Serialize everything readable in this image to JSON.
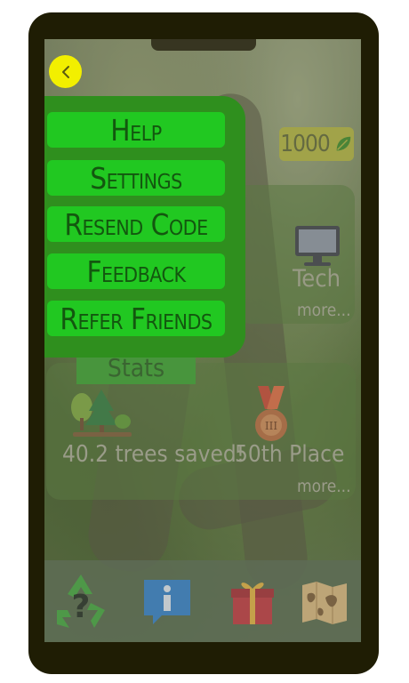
{
  "menu": {
    "items": [
      {
        "label": "Help"
      },
      {
        "label": "Settings"
      },
      {
        "label": "Resend Code"
      },
      {
        "label": "Feedback"
      },
      {
        "label": "Refer Friends"
      }
    ]
  },
  "header": {
    "coins": "1000",
    "coin_icon": "leaf-icon"
  },
  "cards": {
    "tech": {
      "label": "Tech",
      "more": "more..."
    },
    "stats": {
      "tab_label": "Stats",
      "trees_label": "40.2 trees saved!",
      "place_label": "50th Place",
      "more": "more..."
    }
  },
  "icons": {
    "back": "chevron-left-icon",
    "nav": [
      "recycle-question-icon",
      "info-icon",
      "gift-icon",
      "map-icon"
    ]
  },
  "colors": {
    "menu_panel": "#2f8f1e",
    "menu_button": "#21c821",
    "menu_text": "#13570f",
    "back_button": "#f2ef00",
    "device_frame": "#1f1d04"
  }
}
